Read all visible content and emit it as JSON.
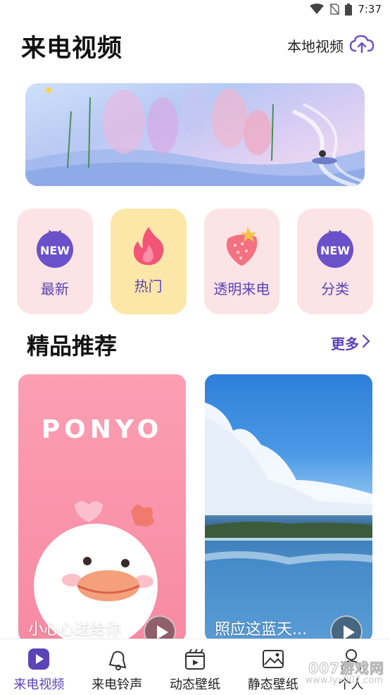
{
  "status_bar": {
    "time": "7:37",
    "icons": [
      "wifi-icon",
      "sim-off-icon",
      "battery-icon"
    ]
  },
  "header": {
    "title": "来电视频",
    "local_video_label": "本地视频",
    "local_video_icon": "cloud-upload-icon"
  },
  "categories": [
    {
      "label": "最新",
      "icon": "new-badge-icon"
    },
    {
      "label": "热门",
      "icon": "flame-icon"
    },
    {
      "label": "透明来电",
      "icon": "strawberry-icon"
    },
    {
      "label": "分类",
      "icon": "new-badge-icon"
    }
  ],
  "category_badge_text": "NEW",
  "section": {
    "title": "精品推荐",
    "more_label": "更多"
  },
  "cards": [
    {
      "title": "小心心送给你",
      "poster_text": "PONYO"
    },
    {
      "title": "照应这蓝天..."
    }
  ],
  "bottom_nav": [
    {
      "label": "来电视频",
      "icon": "play-video-icon",
      "active": true
    },
    {
      "label": "来电铃声",
      "icon": "bell-icon",
      "active": false
    },
    {
      "label": "动态壁纸",
      "icon": "clapper-icon",
      "active": false
    },
    {
      "label": "静态壁纸",
      "icon": "image-icon",
      "active": false
    },
    {
      "label": "个人",
      "icon": "person-icon",
      "active": false
    }
  ],
  "watermark": {
    "text": "007游戏网",
    "sub": "www.lyx007.com"
  },
  "colors": {
    "accent": "#5b43b8",
    "category_bg": "#fbe3e6",
    "hot_bg": "#fde7a8"
  }
}
